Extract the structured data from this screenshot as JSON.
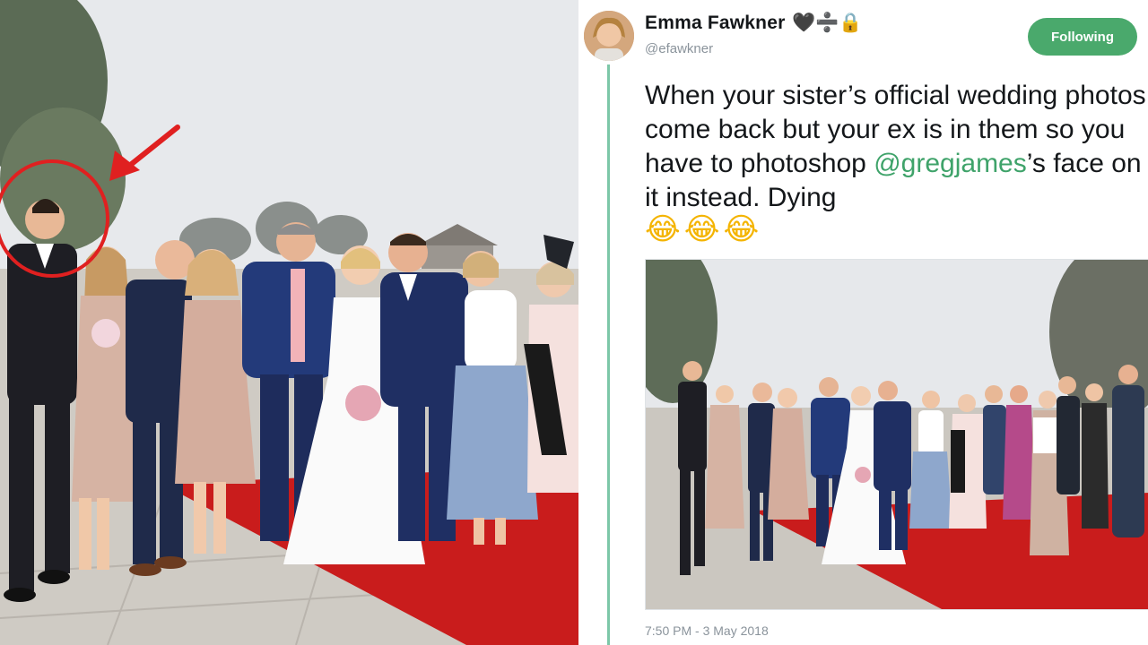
{
  "tweet": {
    "display_name": "Emma Fawkner",
    "name_glyphs": "🖤➗🔒",
    "handle": "@efawkner",
    "follow_label": "Following",
    "text_before_mention": "When your sister’s official wedding photos come back but your ex is in them so you have to photoshop ",
    "mention": "@gregjames",
    "text_after_mention": "’s face on it instead. Dying",
    "emojis": [
      "😂",
      "😂",
      "😂"
    ],
    "timestamp": "7:50 PM - 3 May 2018"
  },
  "annotation": {
    "highlight_color": "#e02020",
    "icons": [
      "red-circle-highlight",
      "red-arrow-icon"
    ]
  },
  "colors": {
    "follow_button": "#4aa96c",
    "mention": "#3fa36a",
    "thread_line": "#7dc7a8",
    "red_carpet": "#c91c1c"
  }
}
